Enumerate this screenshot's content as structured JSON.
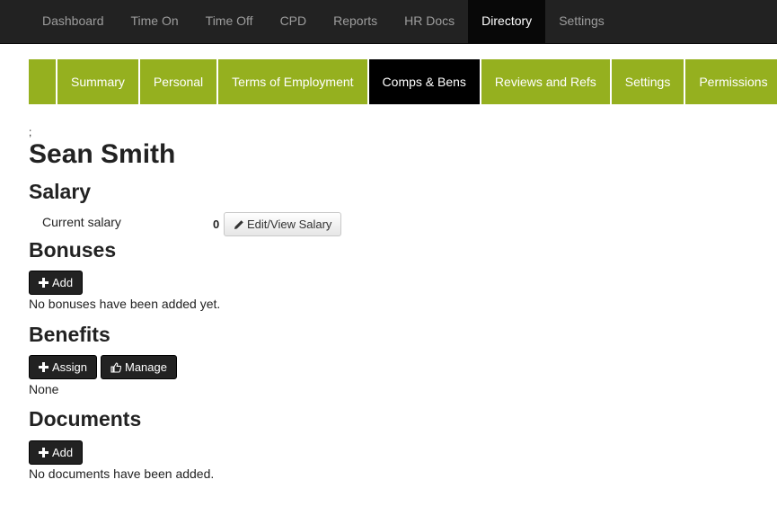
{
  "topnav": {
    "items": [
      {
        "label": "Dashboard"
      },
      {
        "label": "Time On"
      },
      {
        "label": "Time Off"
      },
      {
        "label": "CPD"
      },
      {
        "label": "Reports"
      },
      {
        "label": "HR Docs"
      },
      {
        "label": "Directory",
        "active": true
      },
      {
        "label": "Settings"
      }
    ]
  },
  "subtabs": [
    {
      "label": "Summary"
    },
    {
      "label": "Personal"
    },
    {
      "label": "Terms of Employment"
    },
    {
      "label": "Comps & Bens",
      "active": true
    },
    {
      "label": "Reviews and Refs"
    },
    {
      "label": "Settings"
    },
    {
      "label": "Permissions"
    }
  ],
  "page": {
    "semicolon": ";",
    "person_name": "Sean Smith"
  },
  "salary": {
    "heading": "Salary",
    "label": "Current salary",
    "value": "0",
    "edit_label": "Edit/View Salary"
  },
  "bonuses": {
    "heading": "Bonuses",
    "add_label": "Add",
    "empty_text": "No bonuses have been added yet."
  },
  "benefits": {
    "heading": "Benefits",
    "assign_label": "Assign",
    "manage_label": "Manage",
    "empty_text": "None"
  },
  "documents": {
    "heading": "Documents",
    "add_label": "Add",
    "empty_text": "No documents have been added."
  },
  "icons": {
    "plus": "plus-icon",
    "pencil": "pencil-icon",
    "thumbs_up": "thumbs-up-icon"
  },
  "colors": {
    "navbar": "#222222",
    "navbar_active": "#080808",
    "tabs_green": "#95b01f",
    "tab_active": "#000000",
    "dark_button": "#222222"
  }
}
